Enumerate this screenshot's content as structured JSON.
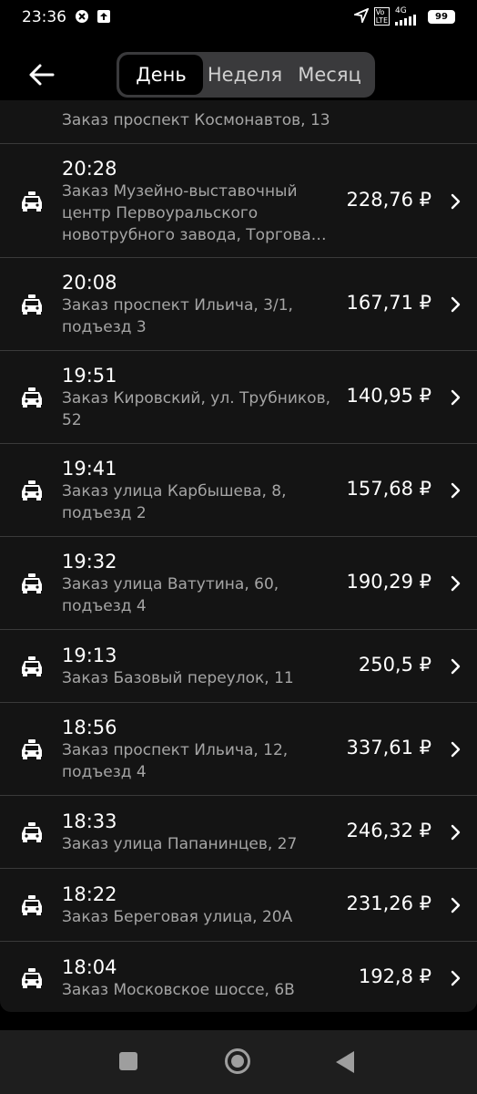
{
  "status": {
    "time": "23:36",
    "battery": "99",
    "network": "4G"
  },
  "tabs": [
    {
      "label": "День",
      "active": true
    },
    {
      "label": "Неделя",
      "active": false
    },
    {
      "label": "Месяц",
      "active": false
    }
  ],
  "partial_row": {
    "address": "Заказ проспект Космонавтов, 13"
  },
  "orders": [
    {
      "time": "20:28",
      "address": "Заказ Музейно-выставочный центр Первоуральского новотрубного завода, Торгова…",
      "price": "228,76 ₽"
    },
    {
      "time": "20:08",
      "address": "Заказ проспект Ильича, 3/1, подъезд 3",
      "price": "167,71 ₽"
    },
    {
      "time": "19:51",
      "address": "Заказ Кировский, ул. Трубников, 52",
      "price": "140,95 ₽"
    },
    {
      "time": "19:41",
      "address": "Заказ улица Карбышева, 8, подъезд 2",
      "price": "157,68 ₽"
    },
    {
      "time": "19:32",
      "address": "Заказ улица Ватутина, 60, подъезд 4",
      "price": "190,29 ₽"
    },
    {
      "time": "19:13",
      "address": "Заказ Базовый переулок, 11",
      "price": "250,5 ₽"
    },
    {
      "time": "18:56",
      "address": "Заказ проспект Ильича, 12, подъезд 4",
      "price": "337,61 ₽"
    },
    {
      "time": "18:33",
      "address": "Заказ улица Папанинцев, 27",
      "price": "246,32 ₽"
    },
    {
      "time": "18:22",
      "address": "Заказ Береговая улица, 20А",
      "price": "231,26 ₽"
    },
    {
      "time": "18:04",
      "address": "Заказ Московское шоссе, 6В",
      "price": "192,8 ₽"
    }
  ],
  "icons": {
    "back": "arrow-left-icon",
    "order": "taxi-car-icon",
    "chevron": "chevron-right-icon"
  },
  "colors": {
    "background": "#000000",
    "list_background": "#141414",
    "secondary_text": "#a5a5a5",
    "segment_bg": "#3a3a3c"
  }
}
